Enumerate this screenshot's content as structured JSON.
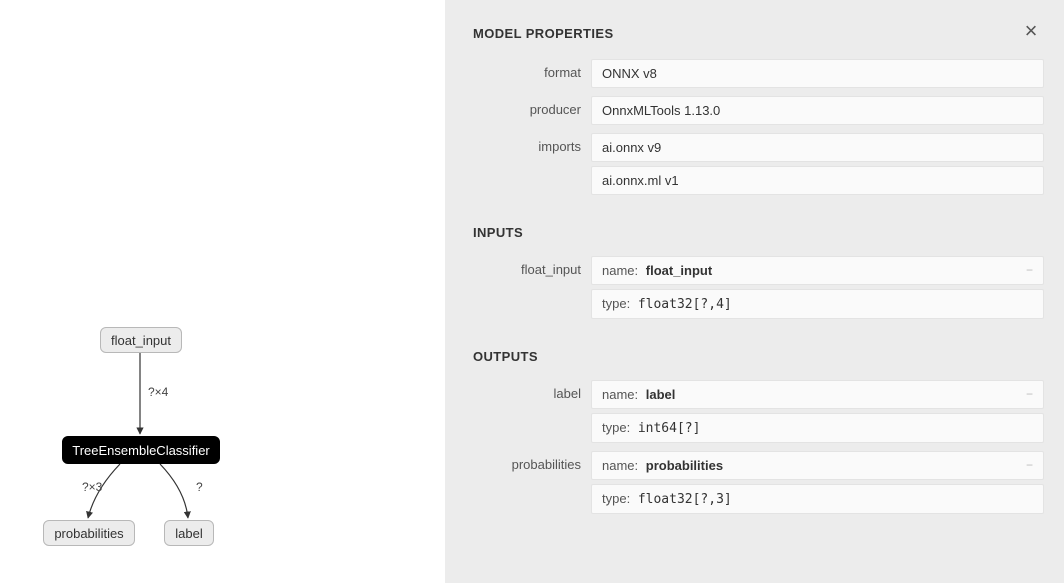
{
  "panel": {
    "title": "MODEL PROPERTIES",
    "sections": {
      "inputs_title": "INPUTS",
      "outputs_title": "OUTPUTS"
    },
    "properties": {
      "format": {
        "label": "format",
        "value": "ONNX v8"
      },
      "producer": {
        "label": "producer",
        "value": "OnnxMLTools 1.13.0"
      },
      "imports": {
        "label": "imports",
        "values": [
          "ai.onnx v9",
          "ai.onnx.ml v1"
        ]
      }
    },
    "inputs": [
      {
        "label": "float_input",
        "name_key": "name:",
        "name_val": "float_input",
        "type_key": "type:",
        "type_val": "float32[?,4]"
      }
    ],
    "outputs": [
      {
        "label": "label",
        "name_key": "name:",
        "name_val": "label",
        "type_key": "type:",
        "type_val": "int64[?]"
      },
      {
        "label": "probabilities",
        "name_key": "name:",
        "name_val": "probabilities",
        "type_key": "type:",
        "type_val": "float32[?,3]"
      }
    ]
  },
  "graph": {
    "input_node": "float_input",
    "op_node": "TreeEnsembleClassifier",
    "out_prob": "probabilities",
    "out_label": "label",
    "edge_in": "?×4",
    "edge_prob": "?×3",
    "edge_label": "?"
  }
}
